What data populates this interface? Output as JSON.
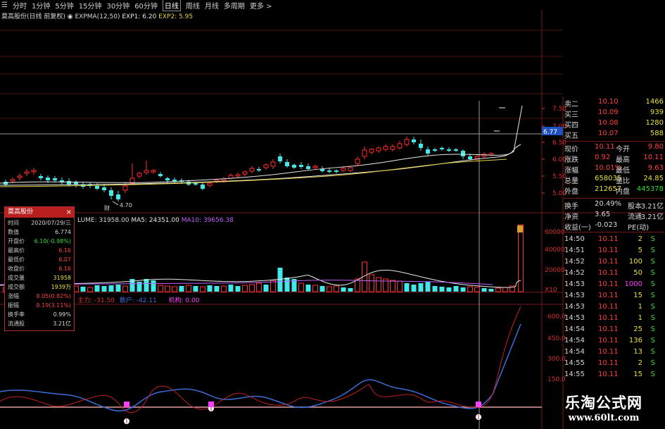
{
  "toolbar": {
    "items": [
      "☰",
      "分时",
      "1分钟",
      "5分钟",
      "15分钟",
      "30分钟",
      "60分钟",
      "日线",
      "周线",
      "月线",
      "多周期",
      "更多 >"
    ],
    "active_index": 7
  },
  "indicator_line": {
    "name": "莫高股份(日线 前复权)",
    "expma": "EXPMA(12,50)",
    "exp1": "EXP1: 6.20",
    "exp2": "EXP2: 5.95"
  },
  "price_axis": {
    "labels": [
      "7.50",
      "7.00",
      "6.50",
      "6.00",
      "5.50",
      "5.00"
    ]
  },
  "crosshair_price": "6.77",
  "low_marker": "4.70",
  "volume_line": {
    "vol": "LUME: 31958.00",
    "ma5": "MA5: 24351.00",
    "ma10": "MA10: 39656.38"
  },
  "volume_axis": {
    "labels": [
      "60000",
      "40000",
      "20000",
      "X10"
    ]
  },
  "indicator2": {
    "a": "主力: -31.50",
    "b": "散户: -42.11",
    "c": "机构: 0.00"
  },
  "indicator2_axis": {
    "labels": [
      "600.0",
      "450.0",
      "300.0",
      "150.0"
    ]
  },
  "quote_panel": {
    "asks": [
      {
        "label": "卖二",
        "price": "10.10",
        "vol": "1466"
      },
      {
        "label": "买三",
        "price": "10.09",
        "vol": "939"
      },
      {
        "label": "买四",
        "price": "10.08",
        "vol": "1280"
      },
      {
        "label": "买五",
        "price": "10.07",
        "vol": "588"
      }
    ],
    "stats": [
      {
        "k1": "现价",
        "v1": "10.11",
        "k2": "今开",
        "v2": "9.80"
      },
      {
        "k1": "涨跌",
        "v1": "0.92",
        "k2": "最高",
        "v2": "10.11"
      },
      {
        "k1": "涨幅",
        "v1": "10.01%",
        "k2": "最低",
        "v2": "9.63"
      },
      {
        "k1": "总量",
        "v1": "658035",
        "k2": "量比",
        "v2": "24.85"
      },
      {
        "k1": "外盘",
        "v1": "212657",
        "k2": "内盘",
        "v2": "445378"
      }
    ],
    "turnover": [
      {
        "k1": "换手",
        "v1": "20.49%",
        "k2": "股本",
        "v2": "3.21亿"
      },
      {
        "k1": "净资",
        "v1": "3.65",
        "k2": "流通",
        "v2": "3.21亿"
      },
      {
        "k1": "收益(一)",
        "v1": "-0.023",
        "k2": "PE(动)",
        "v2": ""
      }
    ],
    "ticks": [
      {
        "time": "14:50",
        "price": "10.11",
        "vol": "2",
        "side": "S"
      },
      {
        "time": "14:51",
        "price": "10.11",
        "vol": "5",
        "side": "S"
      },
      {
        "time": "14:52",
        "price": "10.11",
        "vol": "100",
        "side": "S"
      },
      {
        "time": "14:52",
        "price": "10.11",
        "vol": "50",
        "side": "S"
      },
      {
        "time": "14:53",
        "price": "10.11",
        "vol": "1000",
        "side": "S"
      },
      {
        "time": "14:53",
        "price": "10.11",
        "vol": "15",
        "side": "S"
      },
      {
        "time": "14:53",
        "price": "10.11",
        "vol": "1",
        "side": "S"
      },
      {
        "time": "14:53",
        "price": "10.11",
        "vol": "1",
        "side": "S"
      },
      {
        "time": "14:54",
        "price": "10.11",
        "vol": "25",
        "side": "S"
      },
      {
        "time": "14:54",
        "price": "10.11",
        "vol": "136",
        "side": "S"
      },
      {
        "time": "14:54",
        "price": "10.11",
        "vol": "13",
        "side": "S"
      },
      {
        "time": "14:55",
        "price": "10.11",
        "vol": "2",
        "side": "S"
      },
      {
        "time": "14:55",
        "price": "10.11",
        "vol": "15",
        "side": "S"
      }
    ]
  },
  "popup": {
    "title": "莫高股份",
    "close": "×",
    "rows": [
      {
        "k": "时间",
        "v": "2020/07/29/三",
        "color": "#d8d8d8"
      },
      {
        "k": "数值",
        "v": "6.774",
        "color": "#d8d8d8"
      },
      {
        "k": "开盘价",
        "v": "6.10(-0.98%)",
        "color": "#33dd33"
      },
      {
        "k": "最高价",
        "v": "6.16",
        "color": "#ff4040"
      },
      {
        "k": "最低价",
        "v": "6.07",
        "color": "#ff4040"
      },
      {
        "k": "收盘价",
        "v": "6.16",
        "color": "#ff4040"
      },
      {
        "k": "成交量",
        "v": "31958",
        "color": "#e8e040"
      },
      {
        "k": "成交额",
        "v": "1939万",
        "color": "#e8e040"
      },
      {
        "k": "涨幅",
        "v": "0.05(0.82%)",
        "color": "#ff4040"
      },
      {
        "k": "振幅",
        "v": "0.19(3.11%)",
        "color": "#ff4040"
      },
      {
        "k": "换手率",
        "v": "0.99%",
        "color": "#d8d8d8"
      },
      {
        "k": "流通股",
        "v": "3.21亿",
        "color": "#d8d8d8"
      }
    ]
  },
  "watermark": {
    "title": "乐淘公式网",
    "url": "www.60lt.com"
  },
  "colors": {
    "up": "#ff3030",
    "down": "#40e8e8",
    "ma1": "#e8e8e8",
    "ma2": "#e8d040",
    "kdj1": "#3d6cd8",
    "kdj2": "#c02020"
  }
}
